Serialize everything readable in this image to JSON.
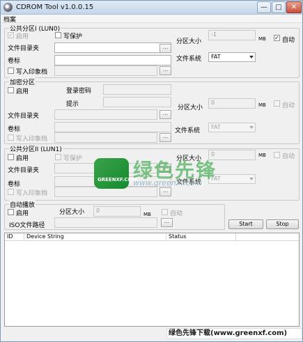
{
  "window": {
    "title": "CDROM Tool v1.0.0.15",
    "controls": {
      "min": "—",
      "max": "□",
      "close": "✕"
    }
  },
  "menu": {
    "label": "档案"
  },
  "group1": {
    "title": "公共分区I (LUN0)",
    "readonly_label": "启用",
    "writeprotect_label": "写保护",
    "dir_label": "文件目录夹",
    "dir_value": "",
    "volume_label": "卷标",
    "volume_value": "",
    "image_label": "写入印象档",
    "image_value": "",
    "size_label": "分区大小",
    "size_value": "-1",
    "unit": "MB",
    "auto_label": "自动",
    "fs_label": "文件系统",
    "fs_value": "FAT",
    "browse": "..."
  },
  "group2": {
    "title": "加密分区",
    "enable_label": "启用",
    "password_label": "登录密码",
    "hint_label": "提示",
    "dir_label": "文件目录夹",
    "volume_label": "卷标",
    "image_label": "写入印象档",
    "size_label": "分区大小",
    "size_value": "0",
    "unit": "MB",
    "auto_label": "自动",
    "fs_label": "文件系统",
    "fs_value": "FAT",
    "browse": "..."
  },
  "group3": {
    "title": "公共分区II (LUN1)",
    "enable_label": "启用",
    "writeprotect_label": "写保护",
    "dir_label": "文件目录夹",
    "volume_label": "卷标",
    "image_label": "写入印象档",
    "size_label": "分区大小",
    "size_value": "0",
    "unit": "MB",
    "auto_label": "自动",
    "fs_label": "文件系统",
    "fs_value": "FAT",
    "browse": "..."
  },
  "autoplay": {
    "title": "自动播放",
    "enable_label": "启用",
    "size_label": "分区大小",
    "size_value": "0",
    "unit": "MB",
    "auto_label": "自动",
    "iso_label": "ISO文件路径",
    "browse": "..."
  },
  "actions": {
    "start": "Start",
    "stop": "Stop"
  },
  "table": {
    "columns": [
      "ID",
      "Device String",
      "Status"
    ]
  },
  "watermark": {
    "brand": "绿色先锋",
    "logo_text": "GREENXF.COM",
    "url": "www.greenxf.com",
    "banner": "绿色先锋下载(www.greenxf.com)"
  }
}
